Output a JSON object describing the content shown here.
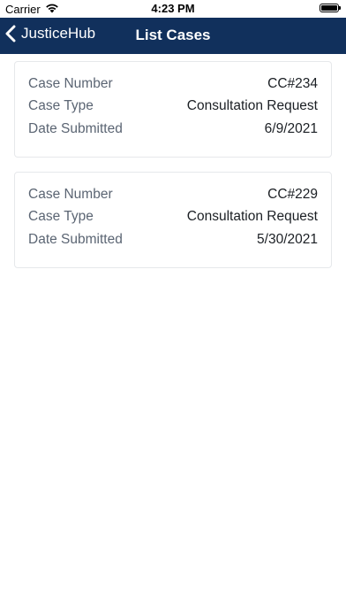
{
  "status_bar": {
    "carrier": "Carrier",
    "time": "4:23 PM",
    "icons": [
      "wifi-icon",
      "battery-icon"
    ]
  },
  "nav": {
    "back_label": "JusticeHub",
    "title": "List Cases",
    "background_color": "#11305c",
    "back_icon": "chevron-left-icon"
  },
  "labels": {
    "case_number": "Case Number",
    "case_type": "Case Type",
    "date_submitted": "Date Submitted"
  },
  "cases": [
    {
      "case_number": "CC#234",
      "case_type": "Consultation Request",
      "date_submitted": "6/9/2021"
    },
    {
      "case_number": "CC#229",
      "case_type": "Consultation Request",
      "date_submitted": "5/30/2021"
    }
  ]
}
